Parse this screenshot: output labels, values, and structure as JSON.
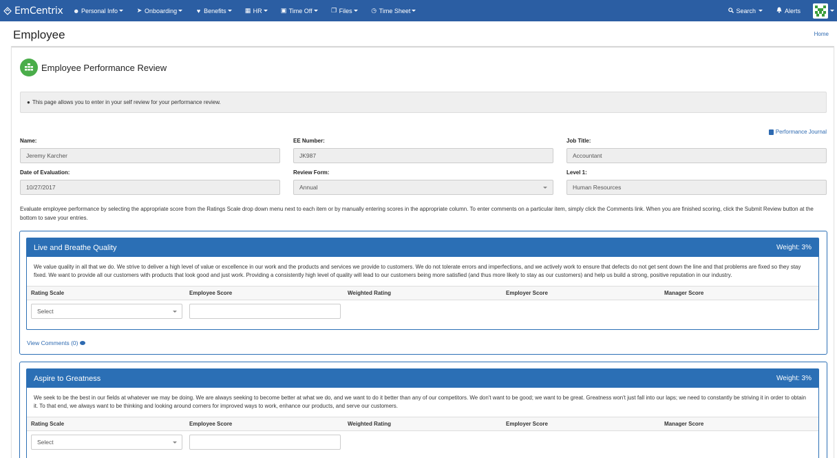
{
  "nav": {
    "brand": "EmCentrix",
    "items": [
      {
        "label": "Personal Info",
        "icon": "user-icon"
      },
      {
        "label": "Onboarding",
        "icon": "rocket-icon"
      },
      {
        "label": "Benefits",
        "icon": "heart-icon"
      },
      {
        "label": "HR",
        "icon": "building-icon"
      },
      {
        "label": "Time Off",
        "icon": "suitcase-icon"
      },
      {
        "label": "Files",
        "icon": "files-icon"
      },
      {
        "label": "Time Sheet",
        "icon": "clock-icon"
      }
    ],
    "search": "Search",
    "alerts": "Alerts"
  },
  "page": {
    "title": "Employee",
    "breadcrumb": "Home"
  },
  "review": {
    "title": "Employee Performance Review",
    "info": "This page allows you to enter in your self review for your performance review.",
    "journal_link": "Performance Journal",
    "fields": {
      "name_label": "Name:",
      "name_value": "Jeremy Karcher",
      "ee_label": "EE Number:",
      "ee_value": "JK987",
      "job_label": "Job Title:",
      "job_value": "Accountant",
      "date_label": "Date of Evaluation:",
      "date_value": "10/27/2017",
      "form_label": "Review Form:",
      "form_value": "Annual",
      "level_label": "Level 1:",
      "level_value": "Human Resources"
    },
    "instructions": "Evaluate employee performance by selecting the appropriate score from the Ratings Scale drop down menu next to each item or by manually entering scores in the appropriate column. To enter comments on a particular item, simply click the Comments link. When you are finished scoring, click the Submit Review button at the bottom to save your entries."
  },
  "columns": [
    "Rating Scale",
    "Employee Score",
    "Weighted Rating",
    "Employer Score",
    "Manager Score"
  ],
  "sections": [
    {
      "title": "Live and Breathe Quality",
      "weight": "Weight: 3%",
      "desc": "We value quality in all that we do. We strive to deliver a high level of value or excellence in our work and the products and services we provide to customers. We do not tolerate errors and imperfections, and we actively work to ensure that defects do not get sent down the line and that problems are fixed so they stay fixed. We want to provide all our customers with products that look good and just work. Providing a consistently high level of quality will lead to our customers being more satisfied (and thus more likely to stay as our customers) and help us build a strong, positive reputation in our industry.",
      "select_placeholder": "Select",
      "comments": "View Comments (0)"
    },
    {
      "title": "Aspire to Greatness",
      "weight": "Weight: 3%",
      "desc": "We seek to be the best in our fields at whatever we may be doing. We are always seeking to become better at what we do, and we want to do it better than any of our competitors. We don't want to be good; we want to be great. Greatness won't just fall into our laps; we need to constantly be striving it in order to obtain it. To that end, we always want to be thinking and looking around corners for improved ways to work, enhance our products, and serve our customers.",
      "select_placeholder": "Select"
    }
  ]
}
